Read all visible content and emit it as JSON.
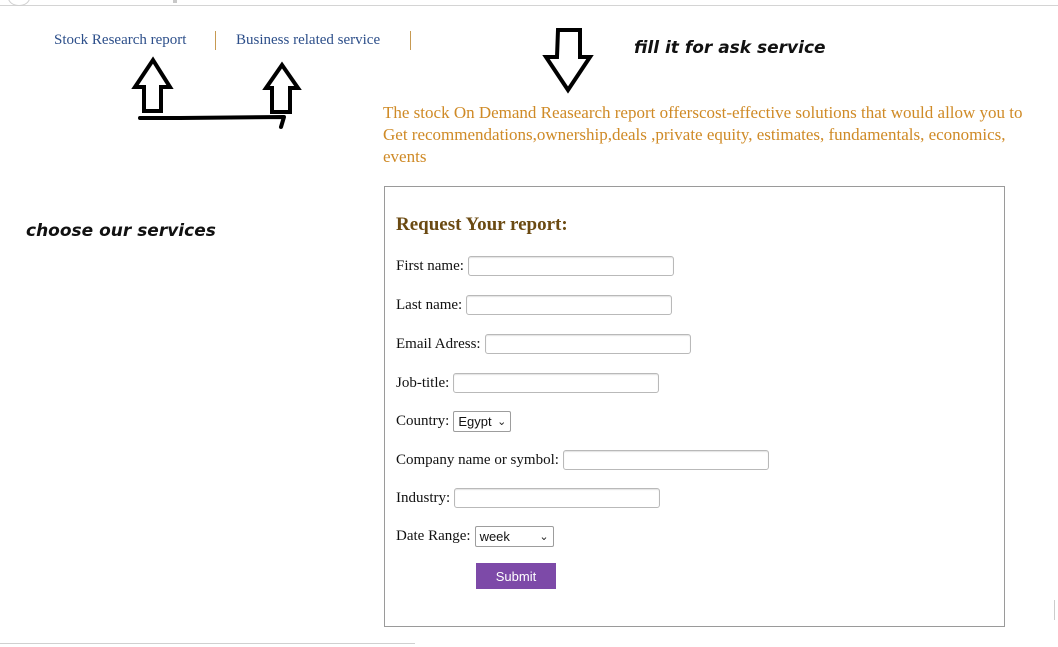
{
  "nav": {
    "stock_research": "Stock Research report",
    "business_service": "Business related service"
  },
  "annotations": {
    "fill_hint": "fill it for ask service",
    "choose_hint": "choose our services"
  },
  "intro_text": "The stock On Demand Reasearch report offerscost-effective solutions that would allow you to Get recommendations,ownership,deals ,private equity, estimates, fundamentals, economics, events",
  "form": {
    "title": "Request Your report:",
    "first_name_label": "First name:",
    "first_name_value": "",
    "last_name_label": "Last name:",
    "last_name_value": "",
    "email_label": "Email Adress:",
    "email_value": "",
    "job_title_label": "Job-title:",
    "job_title_value": "",
    "country_label": "Country:",
    "country_selected": "Egypt",
    "company_label": "Company name or symbol:",
    "company_value": "",
    "industry_label": "Industry:",
    "industry_value": "",
    "date_range_label": "Date Range:",
    "date_range_selected": "week",
    "submit_label": "Submit"
  },
  "colors": {
    "link": "#2d4f8a",
    "intro": "#cf8a26",
    "title": "#6b4a12",
    "submit_bg": "#7d4aa8"
  },
  "icons": {
    "arrow_up": "up-arrow-icon",
    "arrow_down": "down-arrow-icon",
    "select_chevron": "chevron-down-icon"
  }
}
